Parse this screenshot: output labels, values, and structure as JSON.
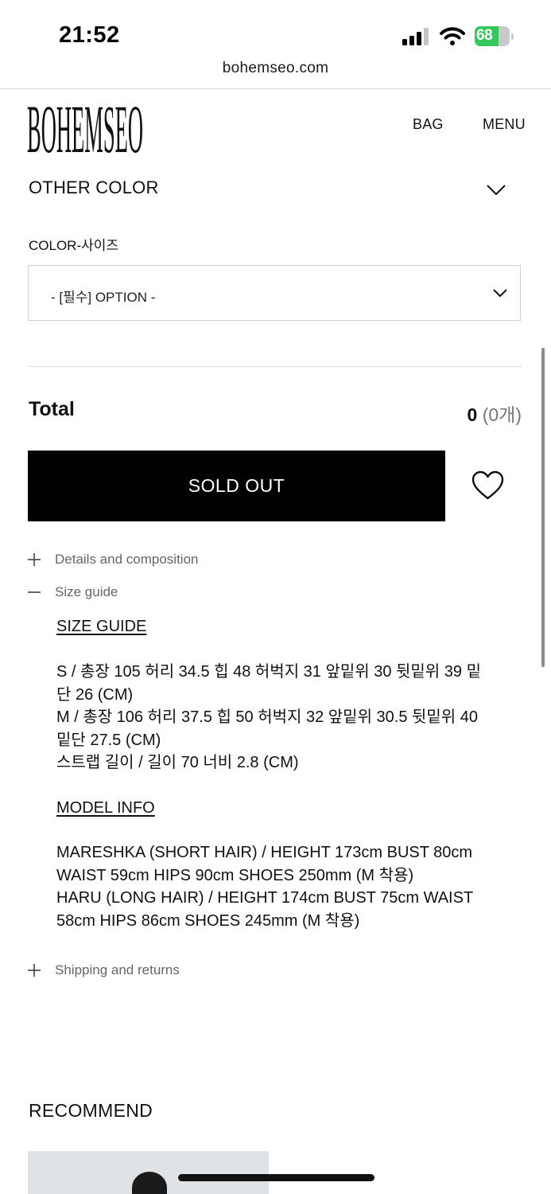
{
  "status_bar": {
    "time": "21:52",
    "battery_level": "68",
    "battery_color": "#34c759",
    "icons": [
      "cellular-signal-icon",
      "wifi-icon",
      "battery-charging-icon"
    ]
  },
  "browser": {
    "url": "bohemseo.com"
  },
  "header": {
    "logo_text": "BOHEMSEO",
    "bag_label": "BAG",
    "menu_label": "MENU"
  },
  "product": {
    "other_color_label": "OTHER COLOR",
    "color_size_label": "COLOR-사이즈",
    "option_selected": "- [필수] OPTION -",
    "total_label": "Total",
    "total_amount": "0",
    "total_count": "(0개)",
    "soldout_label": "SOLD OUT",
    "wishlist_icon": "heart-icon"
  },
  "accordion": {
    "details_label": "Details and composition",
    "size_guide_label": "Size guide",
    "shipping_label": "Shipping and returns",
    "size_guide": {
      "title": "SIZE GUIDE",
      "lines": [
        "S / 총장 105 허리 34.5 힙 48 허벅지 31 앞밑위 30 뒷밑위 39 밑",
        "단 26 (CM)",
        "M / 총장 106 허리 37.5 힙 50 허벅지 32 앞밑위 30.5 뒷밑위 40",
        "밑단 27.5 (CM)",
        "스트랩 길이 / 길이 70 너비 2.8 (CM)"
      ]
    },
    "model_info": {
      "title": "MODEL INFO",
      "lines": [
        "MARESHKA (SHORT HAIR) / HEIGHT 173cm BUST 80cm",
        "WAIST 59cm HIPS 90cm SHOES 250mm (M 착용)",
        "HARU (LONG HAIR) / HEIGHT 174cm BUST 75cm WAIST",
        "58cm HIPS 86cm SHOES 245mm (M 착용)"
      ]
    }
  },
  "recommend": {
    "title": "RECOMMEND"
  }
}
